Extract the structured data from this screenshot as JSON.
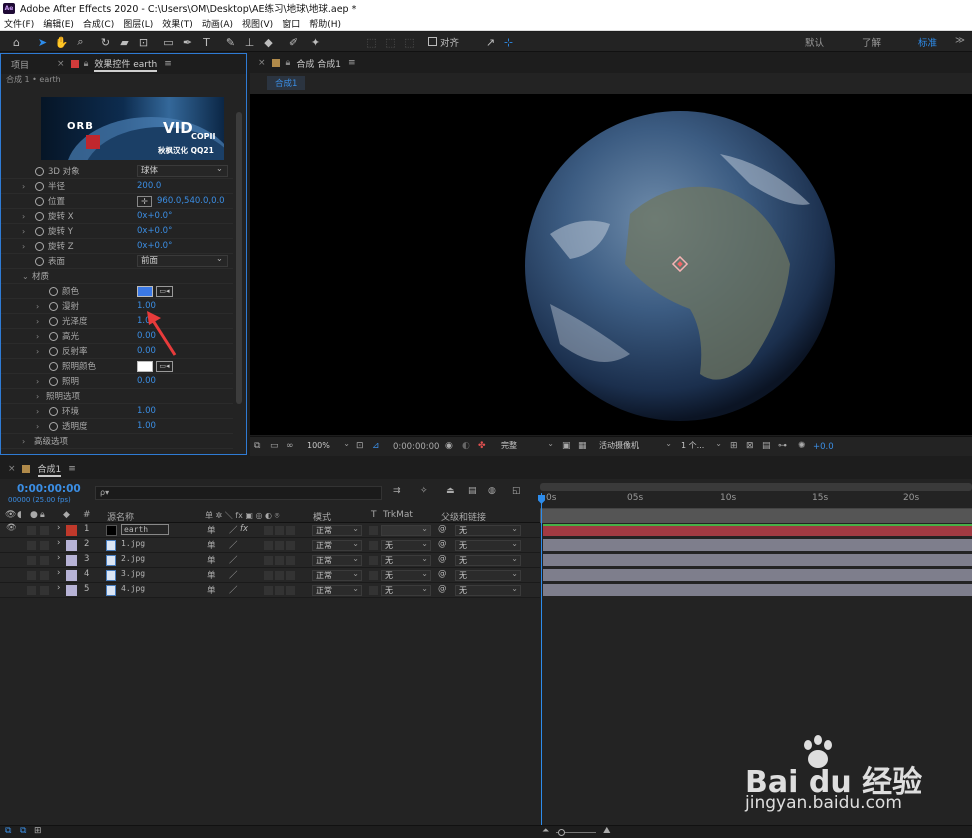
{
  "window": {
    "title": "Adobe After Effects 2020 - C:\\Users\\OM\\Desktop\\AE练习\\地球\\地球.aep *",
    "logo": "Ae"
  },
  "menu": [
    "文件(F)",
    "编辑(E)",
    "合成(C)",
    "图层(L)",
    "效果(T)",
    "动画(A)",
    "视图(V)",
    "窗口",
    "帮助(H)"
  ],
  "toolbar": {
    "snap_label": "对齐",
    "workspaces": [
      "默认",
      "了解",
      "标准"
    ],
    "workspace_menu": "≫"
  },
  "left_panel": {
    "tabs": [
      "项目",
      "效果控件 earth"
    ],
    "breadcrumb": "合成 1 • earth",
    "banner": {
      "orb": "ORB",
      "vid": "VID",
      "copil": "COPII",
      "watermark": "秋枫汉化 QQ21"
    },
    "props": [
      {
        "name": "3D 对象",
        "dropdown": "球体"
      },
      {
        "name": "半径",
        "value": "200.0"
      },
      {
        "name": "位置",
        "value": "960.0,540.0,0.0"
      },
      {
        "name": "旋转 X",
        "value": "0x+0.0°"
      },
      {
        "name": "旋转 Y",
        "value": "0x+0.0°"
      },
      {
        "name": "旋转 Z",
        "value": "0x+0.0°"
      },
      {
        "name": "表面",
        "dropdown": "前面"
      },
      {
        "name": "材质"
      },
      {
        "name": "颜色"
      },
      {
        "name": "漫射",
        "value": "1.00"
      },
      {
        "name": "光泽度",
        "value": "1.00"
      },
      {
        "name": "高光",
        "value": "0.00"
      },
      {
        "name": "反射率",
        "value": "0.00"
      },
      {
        "name": "照明颜色"
      },
      {
        "name": "照明",
        "value": "0.00"
      },
      {
        "name": "照明选项"
      },
      {
        "name": "环境",
        "value": "1.00"
      },
      {
        "name": "透明度",
        "value": "1.00"
      },
      {
        "name": "高级选项"
      }
    ]
  },
  "viewer": {
    "tab": "合成 合成1",
    "comp_tab": "合成1",
    "zoom": "100%",
    "timecode": "0:00:00:00",
    "quality": "完整",
    "camera": "活动摄像机",
    "views": "1 个...",
    "exposure": "+0.0"
  },
  "timeline": {
    "tab": "合成1",
    "timecode": "0:00:00:00",
    "fps": "00000 (25.00 fps)",
    "search_placeholder": "ρ▾",
    "headers": {
      "num": "#",
      "source": "源名称",
      "switches": "单 ✲ ＼ fx ▣ ◎ ◐ ⌾",
      "mode": "模式",
      "t": "T",
      "trkmat": "TrkMat",
      "parent": "父级和链接"
    },
    "ruler": [
      "0s",
      "05s",
      "10s",
      "15s",
      "20s"
    ],
    "layers": [
      {
        "num": "1",
        "name": "earth",
        "label": "#c0392b",
        "mode": "正常",
        "trkmat": "",
        "parent": "无"
      },
      {
        "num": "2",
        "name": "1.jpg",
        "label": "#b7b3d6",
        "mode": "正常",
        "trkmat": "无",
        "parent": "无"
      },
      {
        "num": "3",
        "name": "2.jpg",
        "label": "#b7b3d6",
        "mode": "正常",
        "trkmat": "无",
        "parent": "无"
      },
      {
        "num": "4",
        "name": "3.jpg",
        "label": "#b7b3d6",
        "mode": "正常",
        "trkmat": "无",
        "parent": "无"
      },
      {
        "num": "5",
        "name": "4.jpg",
        "label": "#b7b3d6",
        "mode": "正常",
        "trkmat": "无",
        "parent": "无"
      }
    ]
  },
  "watermark": {
    "brand": "Bai du 经验",
    "url": "jingyan.baidu.com"
  },
  "colors": {
    "accent": "#2d8ceb",
    "red_bar": "#a13a42",
    "gray_bar": "#7e7e8c",
    "annotation": "#e83b3b"
  }
}
